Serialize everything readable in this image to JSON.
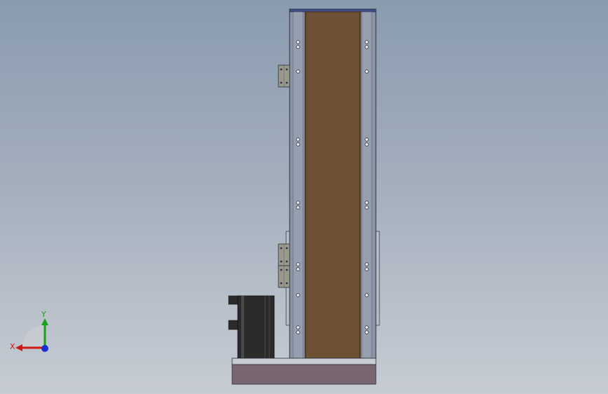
{
  "viewport": {
    "background_top": "#8a9bb0",
    "background_bottom": "#c7ccd3"
  },
  "model": {
    "colors": {
      "frame": "#8c95a6",
      "frame_dark": "#5d6473",
      "frame_light": "#b7bfcc",
      "belt": "#6e5034",
      "belt_edge": "#4a3522",
      "base_plate_top": "#c8ccd4",
      "base_block": "#7a6670",
      "motor": "#2b2b2b",
      "motor_highlight": "#4a4a4a",
      "bracket": "#9a9a8c",
      "hole": "#f4f4f4",
      "outline": "#2a2f3a"
    }
  },
  "triad": {
    "x_label": "X",
    "y_label": "Y",
    "x_color": "#d01818",
    "y_color": "#18a018",
    "z_color": "#1830d0"
  }
}
